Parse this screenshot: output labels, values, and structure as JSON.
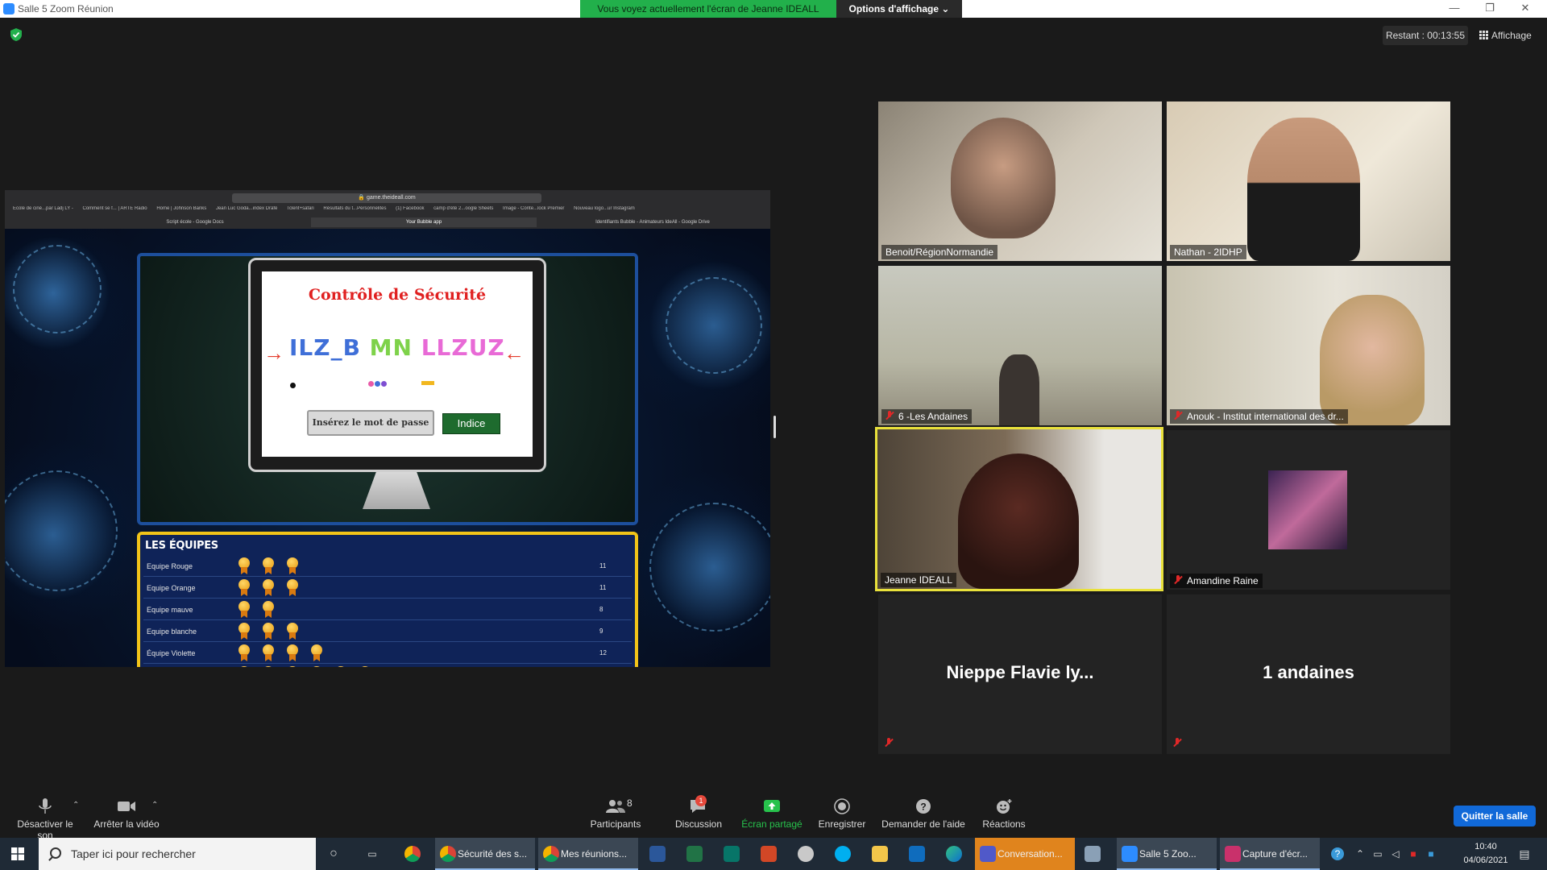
{
  "window": {
    "title": "Salle 5   Zoom Réunion",
    "viewing_banner": "Vous voyez actuellement l'écran de Jeanne IDEALL",
    "view_options": "Options d'affichage ⌄",
    "remaining": "Restant : 00:13:55",
    "layout_label": "Affichage",
    "min": "—",
    "restore": "❐",
    "close": "✕"
  },
  "browser": {
    "url": "🔒 game.theideall.com",
    "bookmarks": [
      "École de ciné...par Ladj LY -",
      "Comment se f... | ARTE Radio",
      "Home | Johnson Banks",
      "Jean Luc Goda...index Dráfé",
      "Tclent+safari",
      "Résultats du t...Personnelites",
      "(1) Facebook",
      "camp d'été 2...oogle Sheets",
      "Image - Conte...lock Premier",
      "Nouveau logo...ur Instagram"
    ],
    "tabs": [
      "Script école - Google Docs",
      "Your Bubble app",
      "Identifiants Bubble - Animateurs IdeAll - Google Drive"
    ]
  },
  "game": {
    "security_title": "Contrôle de Sécurité",
    "code": {
      "part1": "ILZ_B",
      "part2": "MN",
      "part3": "LLZUZ"
    },
    "arrow_left": "→",
    "arrow_right": "←",
    "password_placeholder": "Insérez le mot de passe",
    "hint_label": "Indice",
    "teams_title": "LES ÉQUIPES",
    "teams": [
      {
        "name": "Equipe Rouge",
        "medals": 3,
        "score": "11"
      },
      {
        "name": "Equipe Orange",
        "medals": 3,
        "score": "11"
      },
      {
        "name": "Equipe mauve",
        "medals": 2,
        "score": "8"
      },
      {
        "name": "Equipe blanche",
        "medals": 3,
        "score": "9"
      },
      {
        "name": "Équipe Violette",
        "medals": 4,
        "score": "12"
      },
      {
        "name": "",
        "medals": 6,
        "score": ""
      }
    ]
  },
  "participants": [
    {
      "name": "Benoit/RégionNormandie",
      "muted": false
    },
    {
      "name": "Nathan - 2IDHP",
      "muted": false
    },
    {
      "name": "6 -Les Andaines",
      "muted": true
    },
    {
      "name": "Anouk - Institut international des dr...",
      "muted": true
    },
    {
      "name": "Jeanne IDEALL",
      "muted": false,
      "active": true
    },
    {
      "name": "Amandine Raine",
      "muted": true
    },
    {
      "name": "Nieppe Flavie ly...",
      "muted": true,
      "video": false
    },
    {
      "name": "1 andaines",
      "muted": true,
      "video": false
    }
  ],
  "controls": {
    "mute": "Désactiver le son",
    "video": "Arrêter la vidéo",
    "participants": "Participants",
    "participants_count": "8",
    "chat": "Discussion",
    "chat_badge": "1",
    "share": "Écran partagé",
    "record": "Enregistrer",
    "help": "Demander de l'aide",
    "reactions": "Réactions",
    "leave": "Quitter la salle"
  },
  "taskbar": {
    "search_placeholder": "Taper ici pour rechercher",
    "items": [
      "Sécurité des s...",
      "Mes réunions...",
      "Conversation...",
      "Salle 5   Zoo...",
      "Capture d'écr..."
    ],
    "time": "10:40",
    "date": "04/06/2021"
  },
  "colors": {
    "zoom_blue": "#2d8cff",
    "banner_green": "#22b04b",
    "active_speaker": "#e9e13b",
    "muted_red": "#e02828",
    "leave_blue": "#1169d8"
  }
}
